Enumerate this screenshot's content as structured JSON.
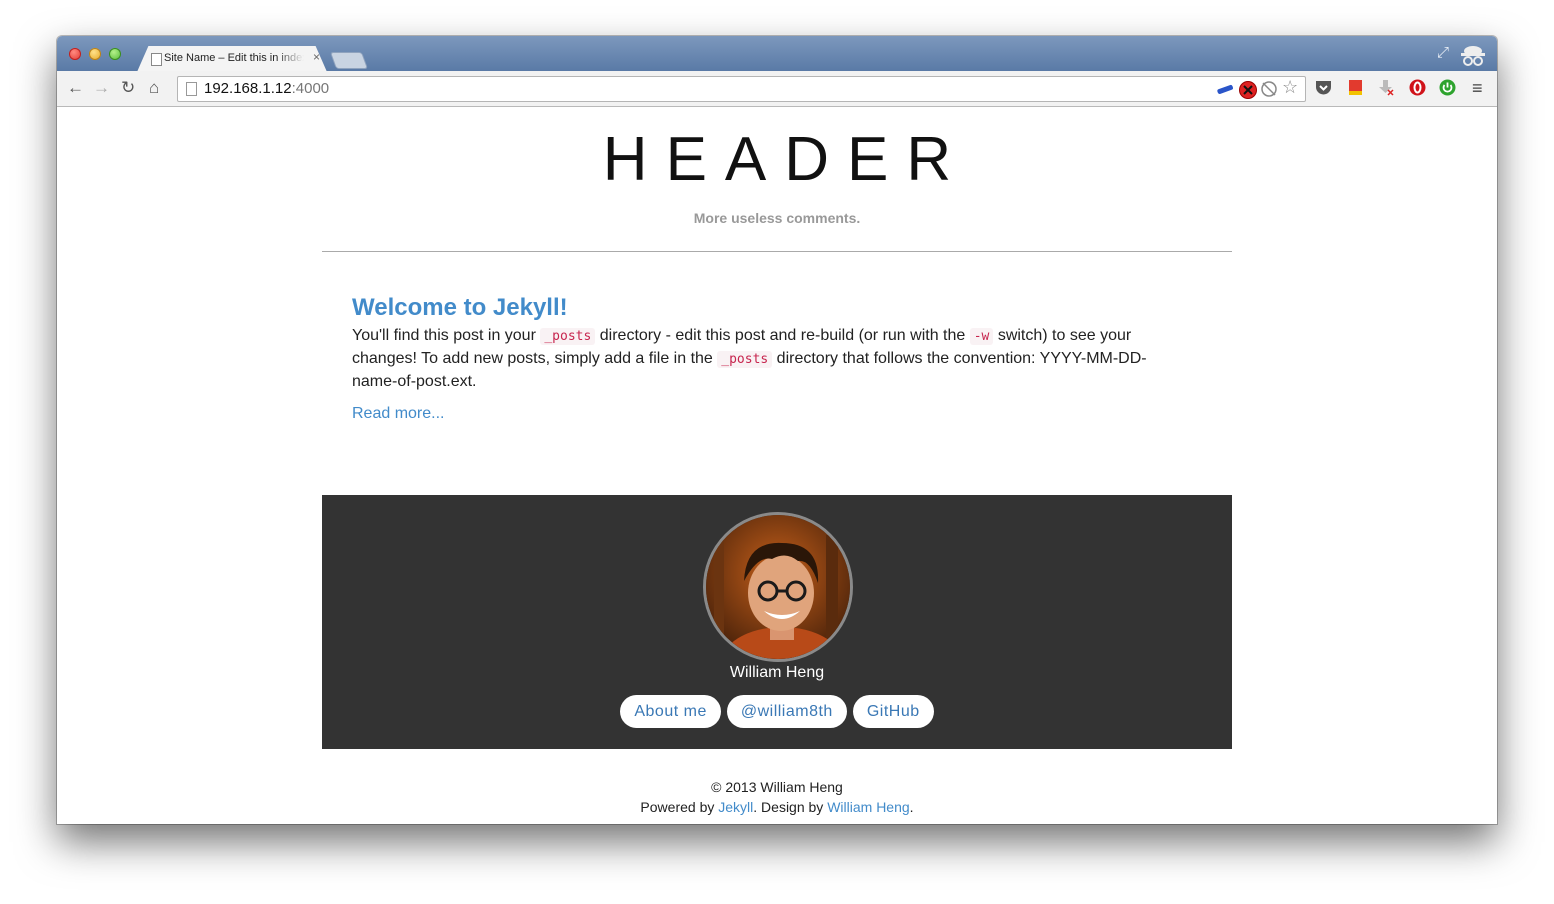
{
  "browser": {
    "tab_title": "Site Name – Edit this in index.html",
    "tab_close": "×",
    "url_host": "192.168.1.12",
    "url_port": ":4000"
  },
  "site": {
    "title": "HEADER",
    "subtitle": "More useless comments."
  },
  "post": {
    "title": "Welcome to Jekyll!",
    "body_1": "You'll find this post in your ",
    "code_1": "_posts",
    "body_2": " directory - edit this post and re-build (or run with the ",
    "code_2": "-w",
    "body_3": " switch) to see your changes! To add new posts, simply add a file in the ",
    "code_3": "_posts",
    "body_4": " directory that follows the convention: YYYY-MM-DD-name-of-post.ext.",
    "read_more": "Read more..."
  },
  "author": {
    "name": "William Heng",
    "buttons": [
      "About me",
      "@william8th",
      "GitHub"
    ]
  },
  "footer": {
    "copyright": "© 2013 William Heng",
    "powered_by": "Powered by ",
    "jekyll_link": "Jekyll",
    "design_by": ". Design by ",
    "designer_link": "William Heng",
    "end": "."
  },
  "colors": {
    "link": "#428bca",
    "panel_bg": "#333333",
    "code": "#c7254e"
  }
}
